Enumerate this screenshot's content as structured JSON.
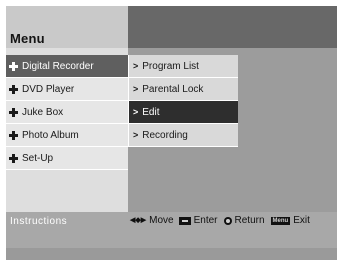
{
  "menu": {
    "title": "Menu"
  },
  "left_menu": {
    "items": [
      {
        "label": "Digital Recorder",
        "selected": true
      },
      {
        "label": "DVD Player",
        "selected": false
      },
      {
        "label": "Juke Box",
        "selected": false
      },
      {
        "label": "Photo Album",
        "selected": false
      },
      {
        "label": "Set-Up",
        "selected": false
      }
    ]
  },
  "sub_menu": {
    "items": [
      {
        "label": "Program List",
        "selected": false
      },
      {
        "label": "Parental Lock",
        "selected": false
      },
      {
        "label": "Edit",
        "selected": true
      },
      {
        "label": "Recording",
        "selected": false
      }
    ]
  },
  "instructions": {
    "label": "Instructions",
    "move": "Move",
    "enter": "Enter",
    "return": "Return",
    "menu_key": "Menu",
    "exit": "Exit"
  },
  "icons": [
    "diamond-bullet-icon",
    "chevron-right-icon",
    "arrow-keys-icon",
    "enter-key-icon",
    "return-key-icon",
    "menu-key-icon"
  ]
}
